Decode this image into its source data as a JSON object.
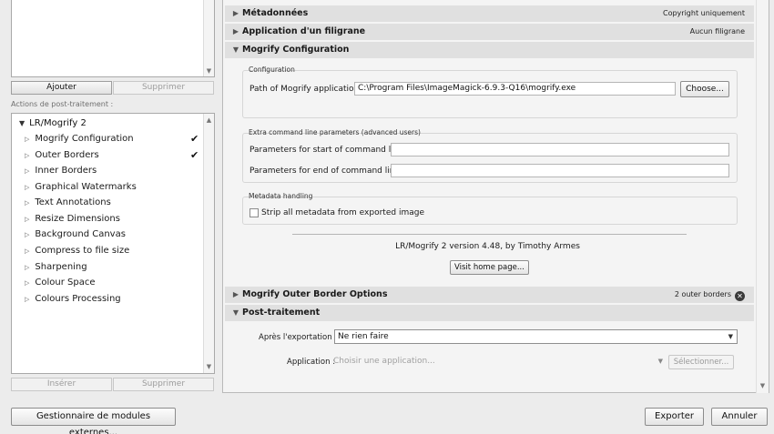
{
  "left": {
    "add_button": "Ajouter",
    "remove_button": "Supprimer",
    "post_actions_label": "Actions de post-traitement :",
    "tree": {
      "root": "LR/Mogrify 2",
      "items": [
        {
          "label": "Mogrify Configuration",
          "checked": true
        },
        {
          "label": "Outer Borders",
          "checked": true
        },
        {
          "label": "Inner Borders",
          "checked": false
        },
        {
          "label": "Graphical Watermarks",
          "checked": false
        },
        {
          "label": "Text Annotations",
          "checked": false
        },
        {
          "label": "Resize Dimensions",
          "checked": false
        },
        {
          "label": "Background Canvas",
          "checked": false
        },
        {
          "label": "Compress to file size",
          "checked": false
        },
        {
          "label": "Sharpening",
          "checked": false
        },
        {
          "label": "Colour Space",
          "checked": false
        },
        {
          "label": "Colours Processing",
          "checked": false
        }
      ]
    },
    "insert_button": "Insérer",
    "remove2_button": "Supprimer"
  },
  "right": {
    "metadata": {
      "title": "Métadonnées",
      "status": "Copyright uniquement"
    },
    "watermark": {
      "title": "Application d'un filigrane",
      "status": "Aucun filigrane"
    },
    "mogrify_config": {
      "title": "Mogrify Configuration",
      "configuration_group": "Configuration",
      "path_label": "Path of Mogrify application:",
      "path_value": "C:\\Program Files\\ImageMagick-6.9.3-Q16\\mogrify.exe",
      "choose_button": "Choose...",
      "extra_group": "Extra command line parameters (advanced users)",
      "start_label": "Parameters for start of command line:",
      "start_value": "",
      "end_label": "Parameters for end of command line:",
      "end_value": "",
      "metadata_group": "Metadata handling",
      "strip_label": "Strip all metadata from exported image",
      "strip_checked": false,
      "version_text": "LR/Mogrify 2 version 4.48, by Timothy Armes",
      "home_button": "Visit home page..."
    },
    "outer_border": {
      "title": "Mogrify Outer Border Options",
      "status": "2 outer borders"
    },
    "post_processing": {
      "title": "Post-traitement",
      "after_export_label": "Après l'exportation :",
      "after_export_value": "Ne rien faire",
      "application_label": "Application :",
      "application_placeholder": "Choisir une application...",
      "select_button": "Sélectionner..."
    }
  },
  "footer": {
    "plugin_manager_button": "Gestionnaire de modules externes...",
    "export_button": "Exporter",
    "cancel_button": "Annuler"
  },
  "icons": {
    "check": "checkmark-icon",
    "expand": "triangle-right-icon",
    "collapse": "triangle-down-icon",
    "close": "close-circle-icon"
  }
}
